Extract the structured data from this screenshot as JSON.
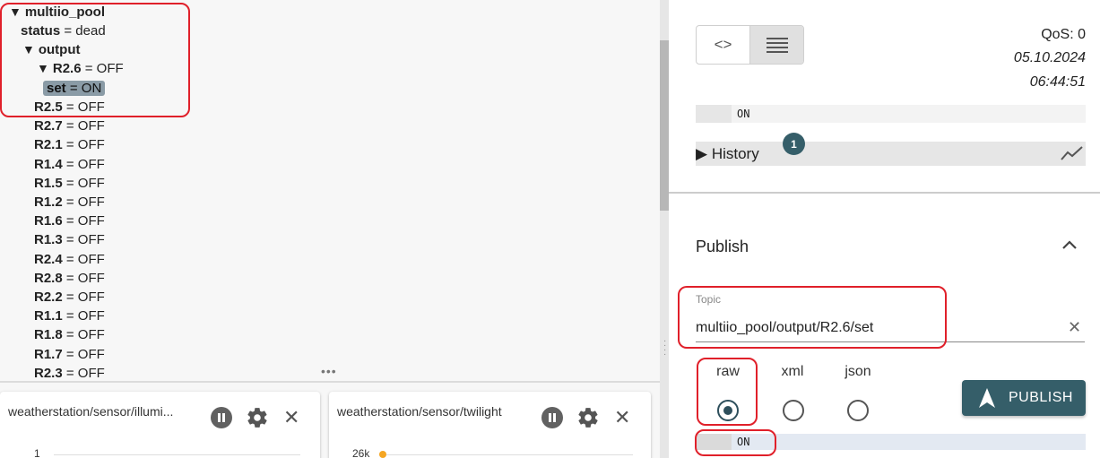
{
  "tree": {
    "root": "multiio_pool",
    "status_key": "status",
    "status_value": "dead",
    "output_key": "output",
    "expanded_key": "R2.6",
    "expanded_value": "OFF",
    "selected_key": "set",
    "selected_value": "ON",
    "items": [
      {
        "key": "R2.5",
        "value": "OFF"
      },
      {
        "key": "R2.7",
        "value": "OFF"
      },
      {
        "key": "R2.1",
        "value": "OFF"
      },
      {
        "key": "R1.4",
        "value": "OFF"
      },
      {
        "key": "R1.5",
        "value": "OFF"
      },
      {
        "key": "R1.2",
        "value": "OFF"
      },
      {
        "key": "R1.6",
        "value": "OFF"
      },
      {
        "key": "R1.3",
        "value": "OFF"
      },
      {
        "key": "R2.4",
        "value": "OFF"
      },
      {
        "key": "R2.8",
        "value": "OFF"
      },
      {
        "key": "R2.2",
        "value": "OFF"
      },
      {
        "key": "R1.1",
        "value": "OFF"
      },
      {
        "key": "R1.8",
        "value": "OFF"
      },
      {
        "key": "R1.7",
        "value": "OFF"
      },
      {
        "key": "R2.3",
        "value": "OFF"
      }
    ],
    "separator": "="
  },
  "charts": [
    {
      "title": "weatherstation/sensor/illumi...",
      "tick": "1"
    },
    {
      "title": "weatherstation/sensor/twilight",
      "tick": "26k"
    }
  ],
  "details": {
    "qos": "QoS: 0",
    "date": "05.10.2024",
    "time": "06:44:51",
    "value": "ON",
    "history_label": "History",
    "history_count": "1"
  },
  "publish": {
    "title": "Publish",
    "topic_label": "Topic",
    "topic_value": "multiio_pool/output/R2.6/set",
    "formats": [
      "raw",
      "xml",
      "json"
    ],
    "selected_format": "raw",
    "button_label": "PUBLISH",
    "payload": "ON"
  },
  "colors": {
    "accent": "#355e69",
    "highlight": "#e0202a",
    "selected_pill": "#8a9ba6",
    "chart_point": "#f5a623"
  }
}
